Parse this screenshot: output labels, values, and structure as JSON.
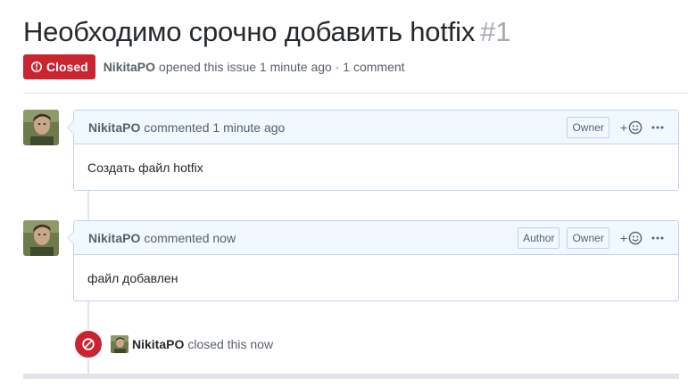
{
  "issue": {
    "title": "Необходимо срочно добавить hotfix",
    "number": "#1",
    "state": "Closed",
    "state_color": "#cb2431",
    "author": "NikitaPO",
    "opened_text": "opened this issue 1 minute ago · 1 comment"
  },
  "comments": [
    {
      "author": "NikitaPO",
      "action": "commented 1 minute ago",
      "labels": [
        "Owner"
      ],
      "reaction_plus": "+",
      "body": "Создать файл hotfix"
    },
    {
      "author": "NikitaPO",
      "action": "commented now",
      "labels": [
        "Author",
        "Owner"
      ],
      "reaction_plus": "+",
      "body": "файл добавлен"
    }
  ],
  "event": {
    "icon": "circle-slash-icon",
    "author": "NikitaPO",
    "text": "closed this now"
  },
  "colors": {
    "header_bg": "#f1f8ff",
    "border": "#c0d3eb",
    "closed_red": "#cb2431",
    "muted_text": "#586069"
  }
}
